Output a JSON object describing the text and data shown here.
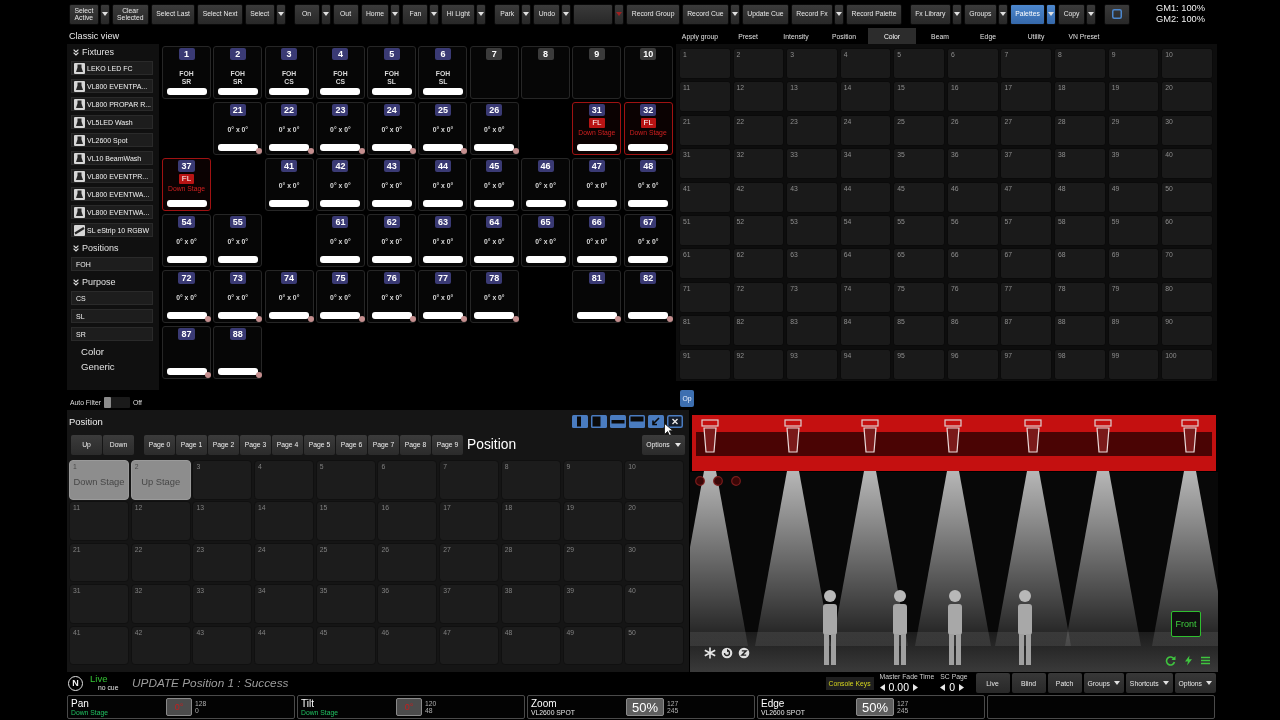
{
  "toolbar": {
    "groups": [
      [
        {
          "kind": "text",
          "label": "Select\nActive",
          "dropdown": true,
          "selected": false
        },
        {
          "kind": "text",
          "label": "Clear\nSelected",
          "dropdown": false,
          "selected": false
        },
        {
          "kind": "text",
          "label": "Select Last",
          "dropdown": false,
          "selected": false
        },
        {
          "kind": "text",
          "label": "Select Next",
          "dropdown": false,
          "selected": false
        },
        {
          "kind": "text",
          "label": "Select",
          "dropdown": true,
          "selected": false
        }
      ],
      [
        {
          "kind": "text",
          "label": "On",
          "dropdown": true,
          "selected": false
        },
        {
          "kind": "text",
          "label": "Out",
          "dropdown": false,
          "selected": false
        },
        {
          "kind": "text",
          "label": "Home",
          "dropdown": true,
          "selected": false
        },
        {
          "kind": "text",
          "label": "Fan",
          "dropdown": true,
          "selected": false
        },
        {
          "kind": "text",
          "label": "Hi Light",
          "dropdown": true,
          "selected": false
        }
      ],
      [
        {
          "kind": "text",
          "label": "Park",
          "dropdown": true,
          "selected": false
        },
        {
          "kind": "text",
          "label": "Undo",
          "dropdown": true,
          "selected": false
        },
        {
          "kind": "alert",
          "dropdown": true,
          "selected": false
        },
        {
          "kind": "text",
          "label": "Record Group",
          "dropdown": false,
          "selected": false
        },
        {
          "kind": "text",
          "label": "Record Cue",
          "dropdown": true,
          "selected": false
        },
        {
          "kind": "text",
          "label": "Update Cue",
          "dropdown": false,
          "selected": false
        },
        {
          "kind": "text",
          "label": "Record Fx",
          "dropdown": true,
          "selected": false
        },
        {
          "kind": "text",
          "label": "Record Palette",
          "dropdown": false,
          "selected": false
        }
      ],
      [
        {
          "kind": "text",
          "label": "Fx Library",
          "dropdown": true,
          "selected": false
        },
        {
          "kind": "text",
          "label": "Groups",
          "dropdown": true,
          "selected": false
        },
        {
          "kind": "text",
          "label": "Palettes",
          "dropdown": true,
          "selected": true
        },
        {
          "kind": "text",
          "label": "Copy",
          "dropdown": true,
          "selected": false
        },
        {
          "kind": "square",
          "dropdown": false,
          "selected": false
        }
      ]
    ],
    "grand_masters": [
      "GM1: 100%",
      "GM2: 100%"
    ]
  },
  "classic_view": {
    "title": "Classic view",
    "sections": [
      {
        "title": "Fixtures",
        "expanded": true,
        "items": [
          {
            "label": "LEKO LED FC",
            "kind": "fixture"
          },
          {
            "label": "VL800 EVENTPA...",
            "kind": "fixture"
          },
          {
            "label": "VL800 PROPAR R...",
            "kind": "fixture"
          },
          {
            "label": "VL5LED Wash",
            "kind": "fixture"
          },
          {
            "label": "VL2600 Spot",
            "kind": "fixture"
          },
          {
            "label": "VL10 BeamWash",
            "kind": "fixture"
          },
          {
            "label": "VL800 EVENTPR...",
            "kind": "fixture"
          },
          {
            "label": "VL800 EVENTWA...",
            "kind": "fixture"
          },
          {
            "label": "VL800 EVENTWA...",
            "kind": "fixture"
          },
          {
            "label": "SL eStrip 10 RGBW",
            "kind": "strip"
          }
        ]
      },
      {
        "title": "Positions",
        "expanded": true,
        "items": [
          {
            "label": "FOH",
            "kind": "group"
          }
        ]
      },
      {
        "title": "Purpose",
        "expanded": true,
        "items": [
          {
            "label": "CS",
            "kind": "group"
          },
          {
            "label": "SL",
            "kind": "group"
          },
          {
            "label": "SR",
            "kind": "group"
          }
        ]
      }
    ],
    "groups": [
      "Color",
      "Generic"
    ],
    "auto_filter": {
      "label": "Auto Filter",
      "on": false,
      "state_text": "Off"
    }
  },
  "fixture_grid": {
    "rows": [
      [
        {
          "number": "1",
          "lines": [
            "FOH",
            "SR"
          ],
          "active": true,
          "highlighted": false,
          "marker": false
        },
        {
          "number": "2",
          "lines": [
            "FOH",
            "SR"
          ],
          "active": true,
          "highlighted": false,
          "marker": false
        },
        {
          "number": "3",
          "lines": [
            "FOH",
            "CS"
          ],
          "active": true,
          "highlighted": false,
          "marker": false
        },
        {
          "number": "4",
          "lines": [
            "FOH",
            "CS"
          ],
          "active": true,
          "highlighted": false,
          "marker": false
        },
        {
          "number": "5",
          "lines": [
            "FOH",
            "SL"
          ],
          "active": true,
          "highlighted": false,
          "marker": false
        },
        {
          "number": "6",
          "lines": [
            "FOH",
            "SL"
          ],
          "active": true,
          "highlighted": false,
          "marker": false
        },
        {
          "number": "7",
          "active": false,
          "highlighted": false,
          "marker": false
        },
        {
          "number": "8",
          "active": false,
          "highlighted": false,
          "marker": false
        },
        {
          "number": "9",
          "active": false,
          "highlighted": false,
          "marker": false
        },
        {
          "number": "10",
          "active": false,
          "highlighted": false,
          "marker": false
        }
      ],
      [
        null,
        {
          "number": "21",
          "lines": [
            "0° x 0°"
          ],
          "active": true,
          "highlighted": false,
          "marker": true
        },
        {
          "number": "22",
          "lines": [
            "0° x 0°"
          ],
          "active": true,
          "highlighted": false,
          "marker": true
        },
        {
          "number": "23",
          "lines": [
            "0° x 0°"
          ],
          "active": true,
          "highlighted": false,
          "marker": true
        },
        {
          "number": "24",
          "lines": [
            "0° x 0°"
          ],
          "active": true,
          "highlighted": false,
          "marker": true
        },
        {
          "number": "25",
          "lines": [
            "0° x 0°"
          ],
          "active": true,
          "highlighted": false,
          "marker": true
        },
        {
          "number": "26",
          "lines": [
            "0° x 0°"
          ],
          "active": true,
          "highlighted": false,
          "marker": true
        },
        null,
        {
          "number": "31",
          "flag": "FL",
          "lines": [
            "Down Stage"
          ],
          "active": true,
          "highlighted": true,
          "marker": false
        },
        {
          "number": "32",
          "flag": "FL",
          "lines": [
            "Down Stage"
          ],
          "active": true,
          "highlighted": true,
          "marker": false
        }
      ],
      [
        {
          "number": "37",
          "flag": "FL",
          "lines": [
            "Down Stage"
          ],
          "active": true,
          "highlighted": true,
          "marker": false
        },
        null,
        {
          "number": "41",
          "lines": [
            "0° x 0°"
          ],
          "active": true,
          "highlighted": false,
          "marker": false
        },
        {
          "number": "42",
          "lines": [
            "0° x 0°"
          ],
          "active": true,
          "highlighted": false,
          "marker": false
        },
        {
          "number": "43",
          "lines": [
            "0° x 0°"
          ],
          "active": true,
          "highlighted": false,
          "marker": false
        },
        {
          "number": "44",
          "lines": [
            "0° x 0°"
          ],
          "active": true,
          "highlighted": false,
          "marker": false
        },
        {
          "number": "45",
          "lines": [
            "0° x 0°"
          ],
          "active": true,
          "highlighted": false,
          "marker": false
        },
        {
          "number": "46",
          "lines": [
            "0° x 0°"
          ],
          "active": true,
          "highlighted": false,
          "marker": false
        },
        {
          "number": "47",
          "lines": [
            "0° x 0°"
          ],
          "active": true,
          "highlighted": false,
          "marker": false
        },
        {
          "number": "48",
          "lines": [
            "0° x 0°"
          ],
          "active": true,
          "highlighted": false,
          "marker": false
        }
      ],
      [
        {
          "number": "54",
          "lines": [
            "0° x 0°"
          ],
          "active": true,
          "highlighted": false,
          "marker": false
        },
        {
          "number": "55",
          "lines": [
            "0° x 0°"
          ],
          "active": true,
          "highlighted": false,
          "marker": false
        },
        null,
        {
          "number": "61",
          "lines": [
            "0° x 0°"
          ],
          "active": true,
          "highlighted": false,
          "marker": false
        },
        {
          "number": "62",
          "lines": [
            "0° x 0°"
          ],
          "active": true,
          "highlighted": false,
          "marker": false
        },
        {
          "number": "63",
          "lines": [
            "0° x 0°"
          ],
          "active": true,
          "highlighted": false,
          "marker": false
        },
        {
          "number": "64",
          "lines": [
            "0° x 0°"
          ],
          "active": true,
          "highlighted": false,
          "marker": false
        },
        {
          "number": "65",
          "lines": [
            "0° x 0°"
          ],
          "active": true,
          "highlighted": false,
          "marker": false
        },
        {
          "number": "66",
          "lines": [
            "0° x 0°"
          ],
          "active": true,
          "highlighted": false,
          "marker": false
        },
        {
          "number": "67",
          "lines": [
            "0° x 0°"
          ],
          "active": true,
          "highlighted": false,
          "marker": false
        }
      ],
      [
        {
          "number": "72",
          "lines": [
            "0° x 0°"
          ],
          "active": true,
          "highlighted": false,
          "marker": true
        },
        {
          "number": "73",
          "lines": [
            "0° x 0°"
          ],
          "active": true,
          "highlighted": false,
          "marker": true
        },
        {
          "number": "74",
          "lines": [
            "0° x 0°"
          ],
          "active": true,
          "highlighted": false,
          "marker": true
        },
        {
          "number": "75",
          "lines": [
            "0° x 0°"
          ],
          "active": true,
          "highlighted": false,
          "marker": true
        },
        {
          "number": "76",
          "lines": [
            "0° x 0°"
          ],
          "active": true,
          "highlighted": false,
          "marker": true
        },
        {
          "number": "77",
          "lines": [
            "0° x 0°"
          ],
          "active": true,
          "highlighted": false,
          "marker": true
        },
        {
          "number": "78",
          "lines": [
            "0° x 0°"
          ],
          "active": true,
          "highlighted": false,
          "marker": true
        },
        null,
        {
          "number": "81",
          "active": true,
          "highlighted": false,
          "marker": true
        },
        {
          "number": "82",
          "active": true,
          "highlighted": false,
          "marker": true
        }
      ],
      [
        {
          "number": "87",
          "active": true,
          "highlighted": false,
          "marker": true
        },
        {
          "number": "88",
          "active": true,
          "highlighted": false,
          "marker": true
        }
      ]
    ]
  },
  "palettes": {
    "tabs": [
      {
        "label": "Apply group",
        "selected": false
      },
      {
        "label": "Preset",
        "selected": false
      },
      {
        "label": "Intensity",
        "selected": false
      },
      {
        "label": "Position",
        "selected": false
      },
      {
        "label": "Color",
        "selected": true
      },
      {
        "label": "Beam",
        "selected": false
      },
      {
        "label": "Edge",
        "selected": false
      },
      {
        "label": "Utility",
        "selected": false
      },
      {
        "label": "VN Preset",
        "selected": false
      }
    ],
    "cells": [
      "1",
      "2",
      "3",
      "4",
      "5",
      "6",
      "7",
      "8",
      "9",
      "10",
      "11",
      "12",
      "13",
      "14",
      "15",
      "16",
      "17",
      "18",
      "19",
      "20",
      "21",
      "22",
      "23",
      "24",
      "25",
      "26",
      "27",
      "28",
      "29",
      "30",
      "31",
      "32",
      "33",
      "34",
      "35",
      "36",
      "37",
      "38",
      "39",
      "40",
      "41",
      "42",
      "43",
      "44",
      "45",
      "46",
      "47",
      "48",
      "49",
      "50",
      "51",
      "52",
      "53",
      "54",
      "55",
      "56",
      "57",
      "58",
      "59",
      "60",
      "61",
      "62",
      "63",
      "64",
      "65",
      "66",
      "67",
      "68",
      "69",
      "70",
      "71",
      "72",
      "73",
      "74",
      "75",
      "76",
      "77",
      "78",
      "79",
      "80",
      "81",
      "82",
      "83",
      "84",
      "85",
      "86",
      "87",
      "88",
      "89",
      "90",
      "91",
      "92",
      "93",
      "94",
      "95",
      "96",
      "97",
      "98",
      "99",
      "100"
    ],
    "overflow_button": "Op"
  },
  "position_window": {
    "title": "Position",
    "nav": [
      "Up",
      "Down"
    ],
    "pages": [
      {
        "label": "Page 0",
        "selected": false
      },
      {
        "label": "Page 1",
        "selected": false
      },
      {
        "label": "Page 2",
        "selected": false
      },
      {
        "label": "Page 3",
        "selected": false
      },
      {
        "label": "Page 4",
        "selected": false
      },
      {
        "label": "Page 5",
        "selected": false
      },
      {
        "label": "Page 6",
        "selected": false
      },
      {
        "label": "Page 7",
        "selected": false
      },
      {
        "label": "Page 8",
        "selected": false
      },
      {
        "label": "Page 9",
        "selected": false
      }
    ],
    "current": "Position",
    "options": "Options",
    "cells": [
      {
        "number": "1",
        "label": "Down Stage",
        "recorded": true
      },
      {
        "number": "2",
        "label": "Up Stage",
        "recorded": true
      },
      {
        "number": "3",
        "recorded": false
      },
      {
        "number": "4",
        "recorded": false
      },
      {
        "number": "5",
        "recorded": false
      },
      {
        "number": "6",
        "recorded": false
      },
      {
        "number": "7",
        "recorded": false
      },
      {
        "number": "8",
        "recorded": false
      },
      {
        "number": "9",
        "recorded": false
      },
      {
        "number": "10",
        "recorded": false
      },
      {
        "number": "11",
        "recorded": false
      },
      {
        "number": "12",
        "recorded": false
      },
      {
        "number": "13",
        "recorded": false
      },
      {
        "number": "14",
        "recorded": false
      },
      {
        "number": "15",
        "recorded": false
      },
      {
        "number": "16",
        "recorded": false
      },
      {
        "number": "17",
        "recorded": false
      },
      {
        "number": "18",
        "recorded": false
      },
      {
        "number": "19",
        "recorded": false
      },
      {
        "number": "20",
        "recorded": false
      },
      {
        "number": "21",
        "recorded": false
      },
      {
        "number": "22",
        "recorded": false
      },
      {
        "number": "23",
        "recorded": false
      },
      {
        "number": "24",
        "recorded": false
      },
      {
        "number": "25",
        "recorded": false
      },
      {
        "number": "26",
        "recorded": false
      },
      {
        "number": "27",
        "recorded": false
      },
      {
        "number": "28",
        "recorded": false
      },
      {
        "number": "29",
        "recorded": false
      },
      {
        "number": "30",
        "recorded": false
      },
      {
        "number": "31",
        "recorded": false
      },
      {
        "number": "32",
        "recorded": false
      },
      {
        "number": "33",
        "recorded": false
      },
      {
        "number": "34",
        "recorded": false
      },
      {
        "number": "35",
        "recorded": false
      },
      {
        "number": "36",
        "recorded": false
      },
      {
        "number": "37",
        "recorded": false
      },
      {
        "number": "38",
        "recorded": false
      },
      {
        "number": "39",
        "recorded": false
      },
      {
        "number": "40",
        "recorded": false
      },
      {
        "number": "41",
        "recorded": false
      },
      {
        "number": "42",
        "recorded": false
      },
      {
        "number": "43",
        "recorded": false
      },
      {
        "number": "44",
        "recorded": false
      },
      {
        "number": "45",
        "recorded": false
      },
      {
        "number": "46",
        "recorded": false
      },
      {
        "number": "47",
        "recorded": false
      },
      {
        "number": "48",
        "recorded": false
      },
      {
        "number": "49",
        "recorded": false
      },
      {
        "number": "50",
        "recorded": false
      }
    ]
  },
  "stage_view": {
    "truss_selected": true,
    "view_button": "Front"
  },
  "status_bar": {
    "logo": "N",
    "mode": "Live",
    "cue": "no cue",
    "message": "UPDATE Position 1 : Success",
    "console_keys": "Console Keys",
    "master_fade": {
      "label": "Master Fade Time",
      "value": "0.00"
    },
    "sc_page": {
      "label": "SC Page",
      "value": "0"
    },
    "buttons": [
      {
        "label": "Live",
        "dropdown": false
      },
      {
        "label": "Blind",
        "dropdown": false
      },
      {
        "label": "Patch",
        "dropdown": false
      },
      {
        "label": "Groups",
        "dropdown": true
      },
      {
        "label": "Shortcuts",
        "dropdown": true
      },
      {
        "label": "Options",
        "dropdown": true
      }
    ]
  },
  "encoders": [
    {
      "kind": "palette",
      "name": "Pan",
      "source": "Down Stage",
      "value": "0°",
      "readings": [
        "128",
        "0"
      ]
    },
    {
      "kind": "palette",
      "name": "Tilt",
      "source": "Down Stage",
      "value": "0°",
      "readings": [
        "120",
        "48"
      ]
    },
    {
      "kind": "fixture",
      "name": "Zoom",
      "source": "VL2600 SPOT",
      "value": "50%",
      "readings": [
        "127",
        "245"
      ]
    },
    {
      "kind": "fixture",
      "name": "Edge",
      "source": "VL2600 SPOT",
      "value": "50%",
      "readings": [
        "127",
        "245"
      ]
    },
    {
      "kind": "empty"
    }
  ]
}
